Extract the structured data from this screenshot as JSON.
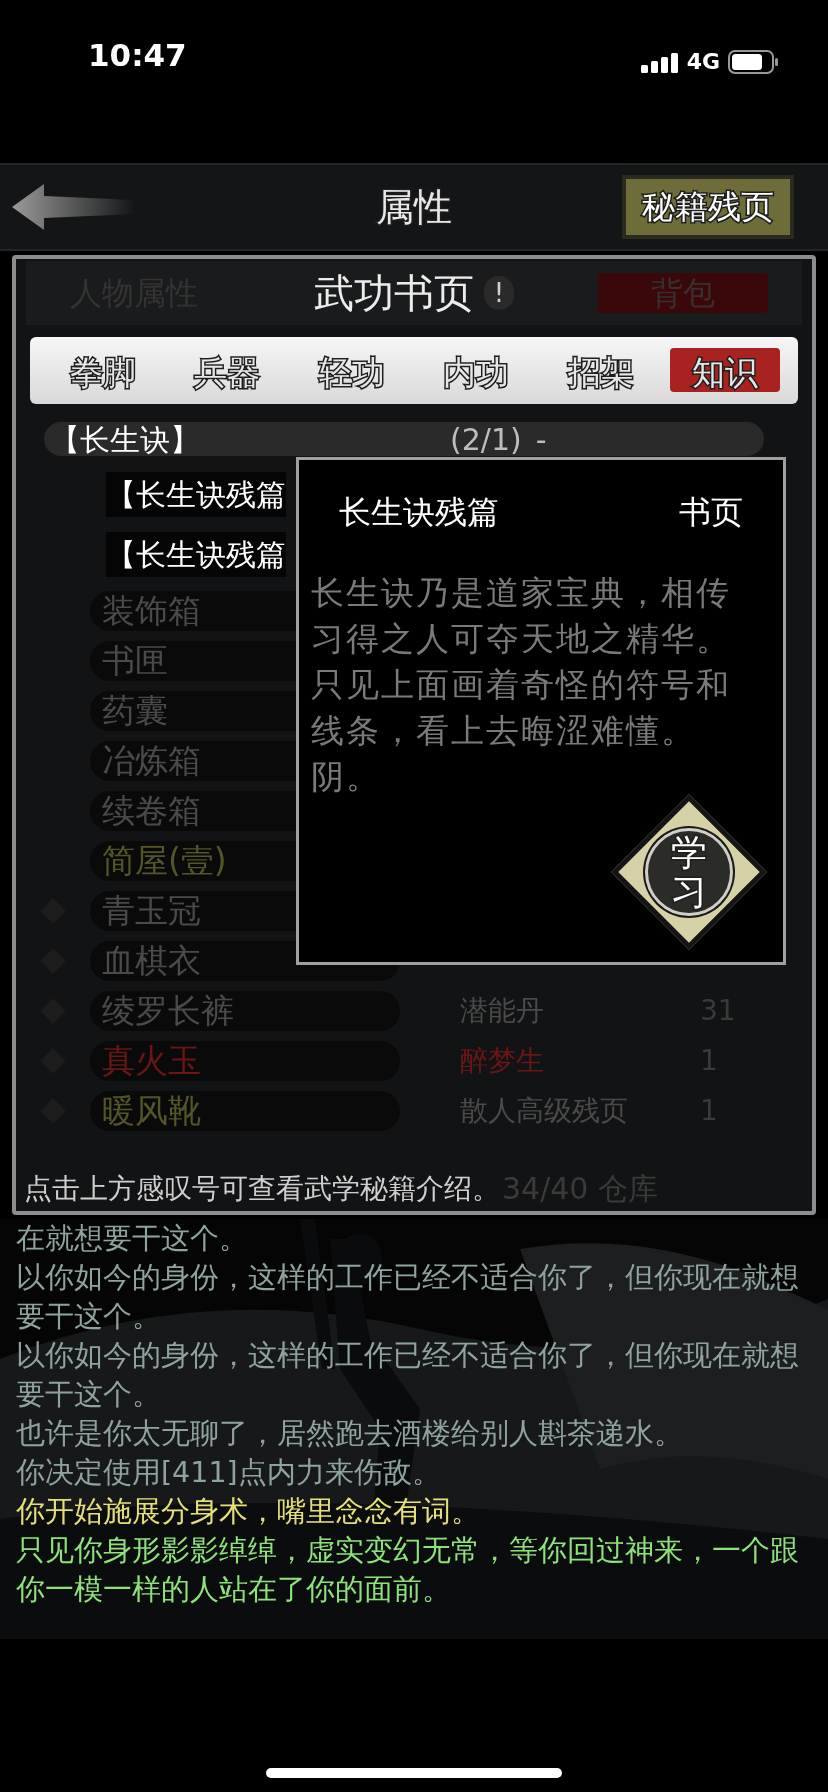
{
  "status_bar": {
    "time": "10:47",
    "network": "4G"
  },
  "header": {
    "title": "属性",
    "action_button": "秘籍残页"
  },
  "panel": {
    "behind_tabs": [
      {
        "label": "人物属性",
        "kind": "plain"
      },
      {
        "label": "背包",
        "kind": "button"
      }
    ],
    "title": "武功书页",
    "info": "!"
  },
  "tabs": [
    {
      "label": "拳脚",
      "selected": false
    },
    {
      "label": "兵器",
      "selected": false
    },
    {
      "label": "轻功",
      "selected": false
    },
    {
      "label": "内功",
      "selected": false
    },
    {
      "label": "招架",
      "selected": false
    },
    {
      "label": "知识",
      "selected": true
    }
  ],
  "background_rows": [
    {
      "marker": false,
      "name": "装饰箱",
      "color": "#4a4a4a"
    },
    {
      "marker": false,
      "name": "书匣",
      "color": "#4a4a4a"
    },
    {
      "marker": false,
      "name": "药囊",
      "color": "#4a4a4a"
    },
    {
      "marker": false,
      "name": "冶炼箱",
      "color": "#4a4a4a"
    },
    {
      "marker": false,
      "name": "续卷箱",
      "color": "#4a4a4a"
    },
    {
      "marker": false,
      "name": "简屋(壹)",
      "color": "#55552a"
    },
    {
      "marker": true,
      "name": "青玉冠",
      "color": "#4a4a4a"
    },
    {
      "marker": true,
      "name": "血棋衣",
      "color": "#4a4a4a"
    },
    {
      "marker": true,
      "name": "绫罗长裤",
      "color": "#4a4a4a",
      "item": {
        "name": "潜能丹",
        "count": "31",
        "color": "#4a4a4a"
      }
    },
    {
      "marker": true,
      "name": "真火玉",
      "color": "#6a1616",
      "item": {
        "name": "醉梦生",
        "count": "1",
        "color": "#6a1616"
      }
    },
    {
      "marker": true,
      "name": "暖风靴",
      "color": "#55552a",
      "item": {
        "name": "散人高级残页",
        "count": "1",
        "color": "#4a4a4a"
      }
    }
  ],
  "skill_group": {
    "name": "【长生诀】",
    "count": "(2/1)",
    "toggle": "-",
    "children": [
      {
        "name": "【长生诀残篇"
      },
      {
        "name": "【长生诀残篇"
      }
    ]
  },
  "popup": {
    "title": "长生诀残篇",
    "type": "书页",
    "description": "长生诀乃是道家宝典，相传习得之人可夺天地之精华。只见上面画着奇怪的符号和线条，看上去晦涩难懂。阴。",
    "button": "学习"
  },
  "footer": {
    "hint": "点击上方感叹号可查看武学秘籍介绍。",
    "storage": "34/40 仓库"
  },
  "log": [
    {
      "text": "在就想要干这个。",
      "color": "#8fa39e"
    },
    {
      "text": "以你如今的身份，这样的工作已经不适合你了，但你现在就想要干这个。",
      "color": "#8fa39e"
    },
    {
      "text": "以你如今的身份，这样的工作已经不适合你了，但你现在就想要干这个。",
      "color": "#8fa39e"
    },
    {
      "text": "也许是你太无聊了，居然跑去酒楼给别人斟茶递水。",
      "color": "#8fa39e"
    },
    {
      "text": "你决定使用[411]点内力来伤敌。",
      "color": "#8fa39e"
    },
    {
      "text": "你开始施展分身术，嘴里念念有词。",
      "color": "#e6df78"
    },
    {
      "text": "只见你身形影影绰绰，虚实变幻无常，等你回过神来，一个跟你一模一样的人站在了你的面前。",
      "color": "#8ee27c"
    }
  ]
}
